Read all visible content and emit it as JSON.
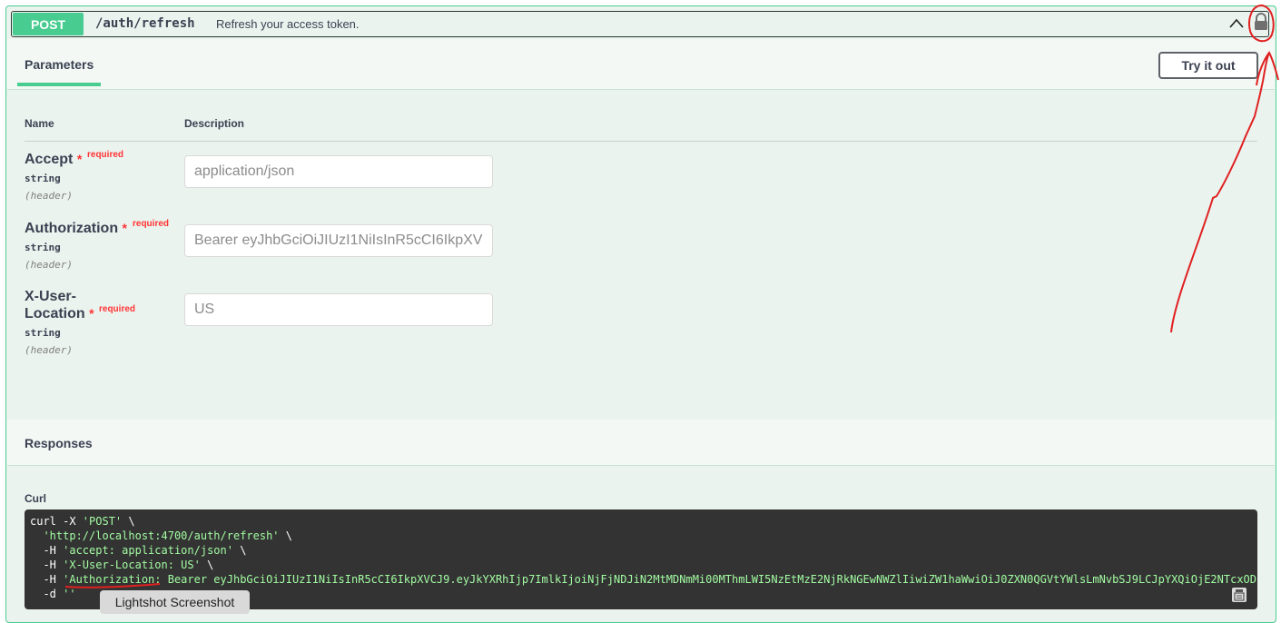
{
  "operation": {
    "method": "POST",
    "path": "/auth/refresh",
    "summary": "Refresh your access token."
  },
  "tabs": {
    "parameters_label": "Parameters",
    "try_it_out_label": "Try it out"
  },
  "table": {
    "col_name": "Name",
    "col_description": "Description",
    "required_star": "*",
    "required_label": "required"
  },
  "params": [
    {
      "name": "Accept",
      "type": "string",
      "in": "(header)",
      "placeholder": "application/json"
    },
    {
      "name": "Authorization",
      "type": "string",
      "in": "(header)",
      "placeholder": "Bearer eyJhbGciOiJIUzI1NiIsInR5cCI6IkpXV"
    },
    {
      "name_line1": "X-User-",
      "name_line2": "Location",
      "type": "string",
      "in": "(header)",
      "placeholder": "US"
    }
  ],
  "responses": {
    "title": "Responses",
    "curl_label": "Curl"
  },
  "curl": {
    "line1_cmd": "curl -X ",
    "line1_str": "'POST'",
    "line1_end": " \\",
    "line2_str": "  'http://localhost:4700/auth/refresh'",
    "line2_end": " \\",
    "line3_flag": "  -H ",
    "line3_str": "'accept: application/json'",
    "line3_end": " \\",
    "line4_flag": "  -H ",
    "line4_str": "'X-User-Location: US'",
    "line4_end": " \\",
    "line5_flag": "  -H ",
    "line5_str": "'Authorization: Bearer eyJhbGciOiJIUzI1NiIsInR5cCI6IkpXVCJ9.eyJkYXRhIjp7ImlkIjoiNjFjNDJiN2MtMDNmMi00MThmLWI5NzEtMzE2NjRkNGEwNWZlIiwiZW1haWwiOiJ0ZXN0QGVtYWlsLmNvbSJ9LCJpYXQiOjE2NTcxODc",
    "line6_flag": "  -d ",
    "line6_str": "''"
  },
  "tooltip": "Lightshot Screenshot",
  "colors": {
    "post_green": "#49cc90",
    "annotation_red": "#e02020",
    "code_bg": "#333333",
    "code_string": "#a2fca2"
  },
  "icons": {
    "chevron": "chevron-up-icon",
    "lock": "lock-icon",
    "copy": "copy-icon"
  }
}
